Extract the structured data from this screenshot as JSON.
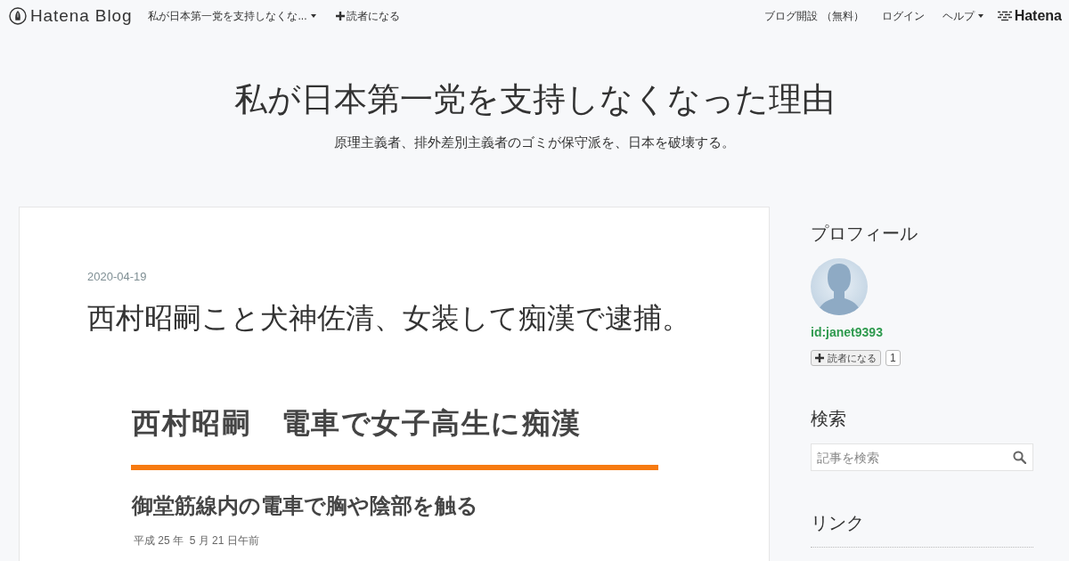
{
  "top_bar": {
    "logo": "Hatena Blog",
    "blog_menu": "私が日本第一党を支持しなくな...",
    "subscribe": "読者になる",
    "links": [
      {
        "label": "ブログ開設 （無料）",
        "kind": "link"
      },
      {
        "label": "ログイン",
        "kind": "link"
      },
      {
        "label": "ヘルプ",
        "kind": "menu"
      }
    ],
    "brand": "Hatena"
  },
  "header": {
    "title": "私が日本第一党を支持しなくなった理由",
    "description": "原理主義者、排外差別主義者のゴミが保守派を、日本を破壊する。"
  },
  "article": {
    "date": "2020-04-19",
    "title": "西村昭嗣こと犬神佐清、女装して痴漢で逮捕。",
    "embedded_document": {
      "headline": "西村昭嗣　電車で女子高生に痴漢",
      "subheadline": "御堂筋線内の電車で胸や陰部を触る",
      "dateline": "平成 25 年  5 月 21 日午前"
    }
  },
  "sidebar": {
    "profile": {
      "heading": "プロフィール",
      "user_id": "id:janet9393",
      "subscribe_button": "読者になる",
      "subscriber_count": "1"
    },
    "search": {
      "heading": "検索",
      "placeholder": "記事を検索"
    },
    "links": {
      "heading": "リンク"
    }
  }
}
